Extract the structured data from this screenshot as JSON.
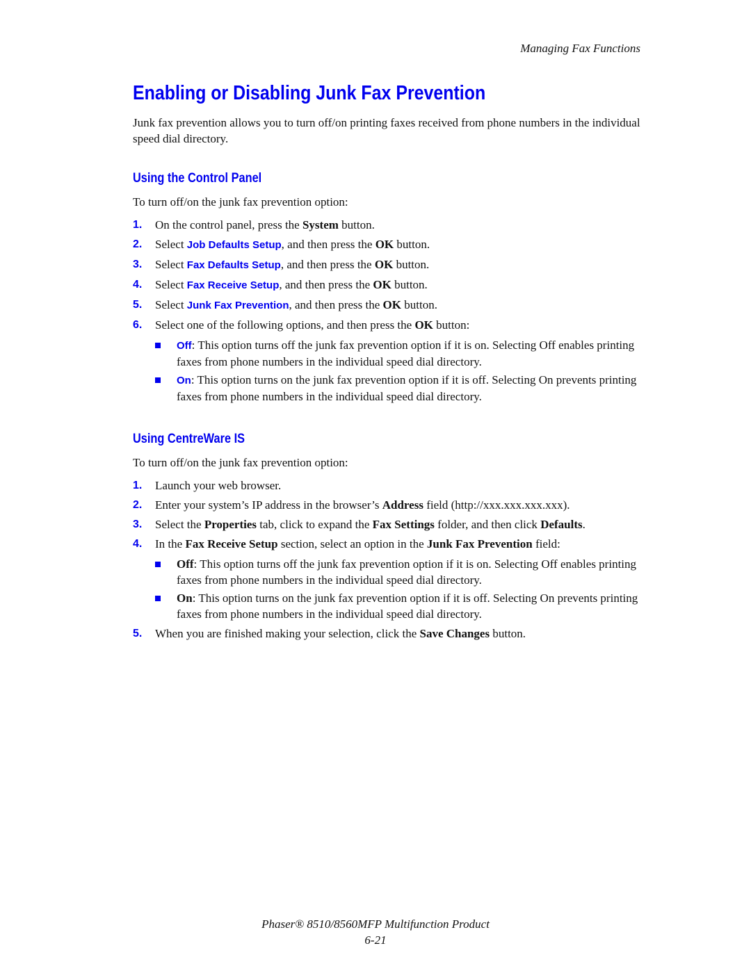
{
  "running_head": "Managing Fax Functions",
  "title": "Enabling or Disabling Junk Fax Prevention",
  "intro": "Junk fax prevention allows you to turn off/on printing faxes received from phone numbers in the individual speed dial directory.",
  "section1": {
    "heading": "Using the Control Panel",
    "lead": "To turn off/on the junk fax prevention option:",
    "steps": [
      {
        "n": "1.",
        "pre": "On the control panel, press the ",
        "bold": "System",
        "post": " button."
      },
      {
        "n": "2.",
        "pre": "Select ",
        "ui": "Job Defaults Setup",
        "mid": ", and then press the ",
        "bold": "OK",
        "post": " button."
      },
      {
        "n": "3.",
        "pre": "Select ",
        "ui": "Fax Defaults Setup",
        "mid": ", and then press the ",
        "bold": "OK",
        "post": " button."
      },
      {
        "n": "4.",
        "pre": "Select ",
        "ui": "Fax Receive Setup",
        "mid": ", and then press the ",
        "bold": "OK",
        "post": " button."
      },
      {
        "n": "5.",
        "pre": "Select ",
        "ui": "Junk Fax Prevention",
        "mid": ", and then press the ",
        "bold": "OK",
        "post": " button."
      },
      {
        "n": "6.",
        "pre": "Select one of the following options, and then press the ",
        "bold": "OK",
        "post": " button:"
      }
    ],
    "options": [
      {
        "label": "Off",
        "text": ": This option turns off the junk fax prevention option if it is on. Selecting Off enables printing faxes from phone numbers in the individual speed dial directory."
      },
      {
        "label": "On",
        "text": ": This option turns on the junk fax prevention option if it is off. Selecting On prevents printing faxes from phone numbers in the individual speed dial directory."
      }
    ]
  },
  "section2": {
    "heading": "Using CentreWare IS",
    "lead": "To turn off/on the junk fax prevention option:",
    "steps": [
      {
        "n": "1.",
        "t1": "Launch your web browser."
      },
      {
        "n": "2.",
        "t1": "Enter your system’s IP address in the browser’s ",
        "b1": "Address",
        "t2": " field (http://xxx.xxx.xxx.xxx)."
      },
      {
        "n": "3.",
        "t1": "Select the ",
        "b1": "Properties",
        "t2": " tab, click to expand the ",
        "b2": "Fax Settings",
        "t3": " folder, and then click ",
        "b3": "Defaults",
        "t4": "."
      },
      {
        "n": "4.",
        "t1": "In the ",
        "b1": "Fax Receive Setup",
        "t2": " section, select an option in the ",
        "b2": "Junk Fax Prevention",
        "t3": " field:"
      },
      {
        "n": "5.",
        "t1": "When you are finished making your selection, click the ",
        "b1": "Save Changes",
        "t2": " button."
      }
    ],
    "options": [
      {
        "label": "Off",
        "text": ": This option turns off the junk fax prevention option if it is on. Selecting Off enables printing faxes from phone numbers in the individual speed dial directory."
      },
      {
        "label": "On",
        "text": ": This option turns on the junk fax prevention option if it is off. Selecting On prevents printing faxes from phone numbers in the individual speed dial directory."
      }
    ]
  },
  "footer": {
    "product": "Phaser® 8510/8560MFP Multifunction Product",
    "page": "6-21"
  },
  "colors": {
    "accent": "#0000ee",
    "text": "#111111"
  }
}
